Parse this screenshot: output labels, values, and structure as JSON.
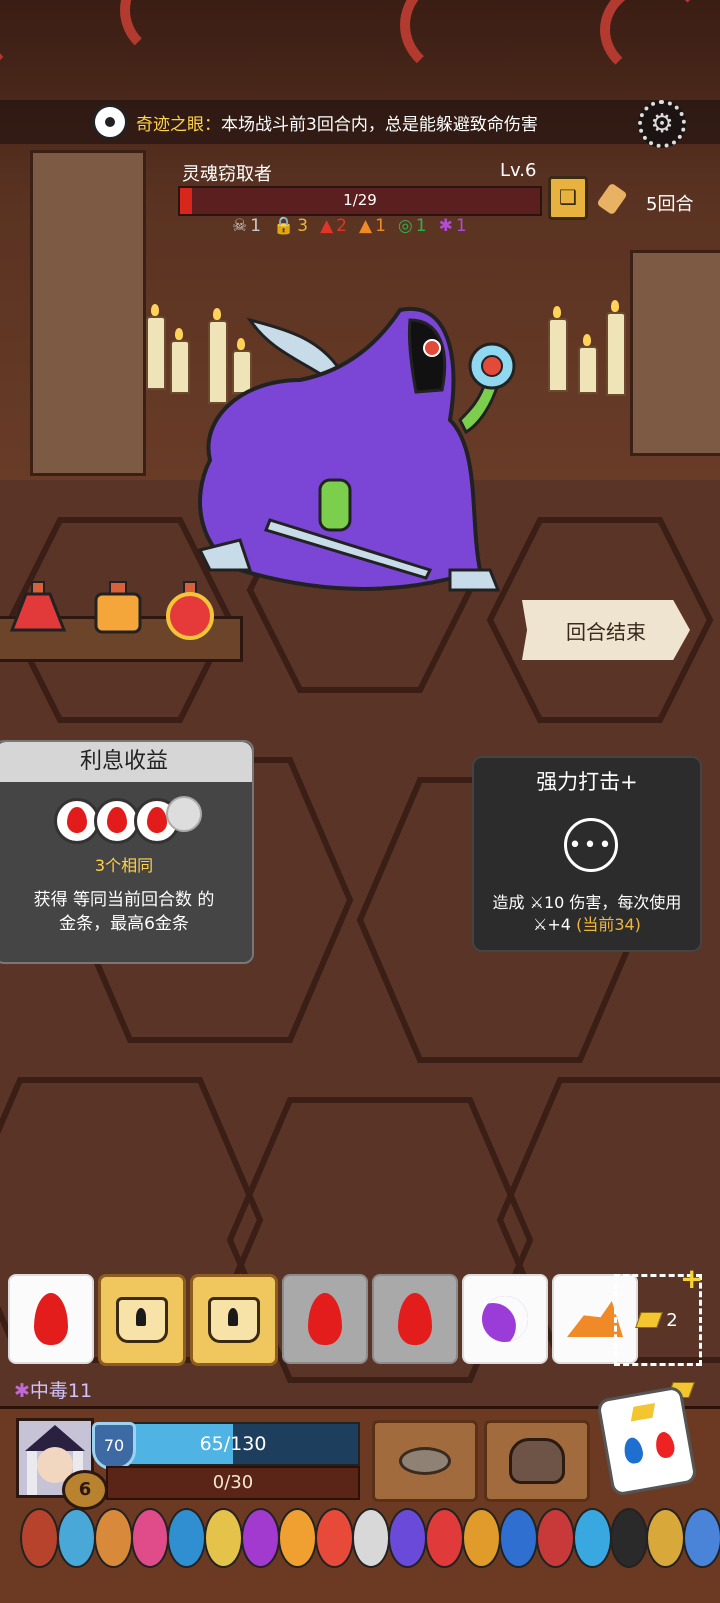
{
  "notice": {
    "icon": "eye-icon",
    "name": "奇迹之眼：",
    "text": "本场战斗前3回合内，总是能躲避致命伤害"
  },
  "enemy": {
    "name": "灵魂窃取者",
    "level": "Lv.6",
    "hp_text": "1/29",
    "hp_fraction": 0.034,
    "statuses": [
      {
        "icon": "skull-icon",
        "value": "1",
        "color": "#c9c9c9"
      },
      {
        "icon": "lock-icon",
        "value": "3",
        "color": "#e9b43c"
      },
      {
        "icon": "fire-icon",
        "value": "2",
        "color": "#e2352a"
      },
      {
        "icon": "flame-icon",
        "value": "1",
        "color": "#f08a26"
      },
      {
        "icon": "vortex-icon",
        "value": "1",
        "color": "#2fb24b"
      },
      {
        "icon": "poison-icon",
        "value": "1",
        "color": "#b34ad8"
      }
    ]
  },
  "turns": "5回合",
  "end_turn": "回合结束",
  "interest_card": {
    "title": "利息收益",
    "same": "3个相同",
    "desc1": "获得 等同当前回合数 的",
    "desc2": "金条，最高6金条"
  },
  "strike_card": {
    "title": "强力打击+",
    "desc1": "造成 ",
    "dmg": "10",
    "desc2": " 伤害，每次使用",
    "plus": "+4",
    "current": "(当前34)"
  },
  "dice": [
    {
      "type": "white",
      "face": "fire"
    },
    {
      "type": "gold",
      "face": "lock"
    },
    {
      "type": "gold",
      "face": "lock"
    },
    {
      "type": "gray",
      "face": "fire"
    },
    {
      "type": "gray",
      "face": "fire"
    },
    {
      "type": "white",
      "face": "moon"
    },
    {
      "type": "white",
      "face": "rock"
    }
  ],
  "gold_count": "2",
  "poison": "中毒11",
  "player": {
    "level": "6",
    "shield": "70",
    "hp_text": "65/130",
    "hp_fraction": 0.5,
    "xp_text": "0/30"
  },
  "colors": {
    "accent_gold": "#ffd24a",
    "hp_red": "#d8261c",
    "hp_blue": "#4fb3e4"
  }
}
